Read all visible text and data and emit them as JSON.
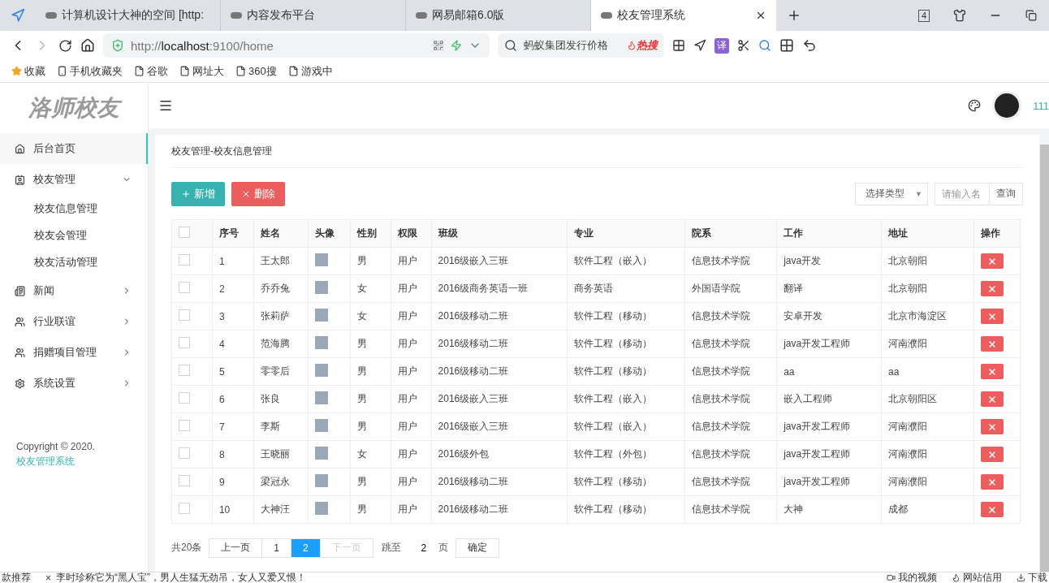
{
  "browser": {
    "tabs": [
      {
        "title": "计算机设计大神的空间 [http:",
        "selected": false
      },
      {
        "title": "内容发布平台",
        "selected": false
      },
      {
        "title": "网易邮箱6.0版",
        "selected": false
      },
      {
        "title": "校友管理系统",
        "selected": true
      }
    ],
    "tab_count": "4",
    "address": {
      "scheme": "http://",
      "host": "localhost",
      "rest": ":9100/home"
    },
    "search": {
      "value": "蚂蚁集团发行价格",
      "hot": "热搜"
    },
    "translate": "译",
    "bookmarks": [
      "收藏",
      "手机收藏夹",
      "谷歌",
      "网址大",
      "360搜",
      "游戏中"
    ],
    "status_bar": {
      "left": "款推荐",
      "close": "×",
      "news": "李时珍称它为“黑人宝”，男人生猛无劲吊，女人又爱又恨！",
      "links": [
        "我的视频",
        "网站信用",
        "下载"
      ]
    }
  },
  "app": {
    "logo": "洛师校友",
    "user": "111",
    "sidebar": [
      {
        "label": "后台首页",
        "selected": true,
        "expanded": false
      },
      {
        "label": "校友管理",
        "selected": false,
        "expanded": true,
        "children": [
          {
            "label": "校友信息管理"
          },
          {
            "label": "校友会管理"
          },
          {
            "label": "校友活动管理"
          }
        ]
      },
      {
        "label": "新闻",
        "selected": false,
        "expanded": false
      },
      {
        "label": "行业联谊",
        "selected": false,
        "expanded": false
      },
      {
        "label": "捐赠项目管理",
        "selected": false,
        "expanded": false
      },
      {
        "label": "系统设置",
        "selected": false,
        "expanded": false
      }
    ],
    "copyright": {
      "text": "Copyright © 2020. ",
      "link": "校友管理系统"
    },
    "breadcrumb": "校友管理-校友信息管理",
    "add_button": "新增",
    "delete_button": "删除",
    "filter": {
      "placeholder": "选择类型",
      "caret": "▼"
    },
    "search": {
      "placeholder": "请输入名"
    },
    "query_button": "查询",
    "table": {
      "all_checked": false,
      "columns": [
        "序号",
        "姓名",
        "头像",
        "性别",
        "权限",
        "班级",
        "专业",
        "院系",
        "工作",
        "地址",
        "操作"
      ],
      "rows": [
        {
          "checked": false,
          "cells": [
            "1",
            "王太郎",
            "",
            "男",
            "用户",
            "2016级嵌入三班",
            "软件工程（嵌入）",
            "信息技术学院",
            "java开发",
            "北京朝阳"
          ]
        },
        {
          "checked": false,
          "cells": [
            "2",
            "乔乔兔",
            "",
            "女",
            "用户",
            "2016级商务英语一班",
            "商务英语",
            "外国语学院",
            "翻译",
            "北京朝阳"
          ]
        },
        {
          "checked": false,
          "cells": [
            "3",
            "张莉萨",
            "",
            "女",
            "用户",
            "2016级移动二班",
            "软件工程（移动）",
            "信息技术学院",
            "安卓开发",
            "北京市海淀区"
          ]
        },
        {
          "checked": false,
          "cells": [
            "4",
            "范海腾",
            "",
            "男",
            "用户",
            "2016级移动二班",
            "软件工程（移动）",
            "信息技术学院",
            "java开发工程师",
            "河南濮阳"
          ]
        },
        {
          "checked": false,
          "cells": [
            "5",
            "零零后",
            "",
            "男",
            "用户",
            "2016级移动二班",
            "软件工程（移动）",
            "信息技术学院",
            "aa",
            "aa"
          ]
        },
        {
          "checked": false,
          "cells": [
            "6",
            "张良",
            "",
            "男",
            "用户",
            "2016级嵌入三班",
            "软件工程（嵌入）",
            "信息技术学院",
            "嵌入工程师",
            "北京朝阳区"
          ]
        },
        {
          "checked": false,
          "cells": [
            "7",
            "李斯",
            "",
            "男",
            "用户",
            "2016级嵌入三班",
            "软件工程（嵌入）",
            "信息技术学院",
            "java开发工程师",
            "河南濮阳"
          ]
        },
        {
          "checked": false,
          "cells": [
            "8",
            "王晓丽",
            "",
            "女",
            "用户",
            "2016级外包",
            "软件工程（外包）",
            "信息技术学院",
            "java开发工程师",
            "河南濮阳"
          ]
        },
        {
          "checked": false,
          "cells": [
            "9",
            "梁冠永",
            "",
            "男",
            "用户",
            "2016级移动二班",
            "软件工程（移动）",
            "信息技术学院",
            "java开发工程师",
            "河南濮阳"
          ]
        },
        {
          "checked": false,
          "cells": [
            "10",
            "大神汪",
            "",
            "男",
            "用户",
            "2016级移动二班",
            "软件工程（移动）",
            "信息技术学院",
            "大神",
            "成都"
          ]
        }
      ]
    },
    "pagination": {
      "total": "共20条",
      "prev": {
        "label": "上一页",
        "disabled": false
      },
      "pages": [
        {
          "label": "1",
          "selected": false
        },
        {
          "label": "2",
          "selected": true
        }
      ],
      "next": {
        "label": "下一页",
        "disabled": true
      },
      "jump_label": "跳至",
      "jump_value": "2",
      "page_unit": "页",
      "confirm": "确定"
    }
  }
}
